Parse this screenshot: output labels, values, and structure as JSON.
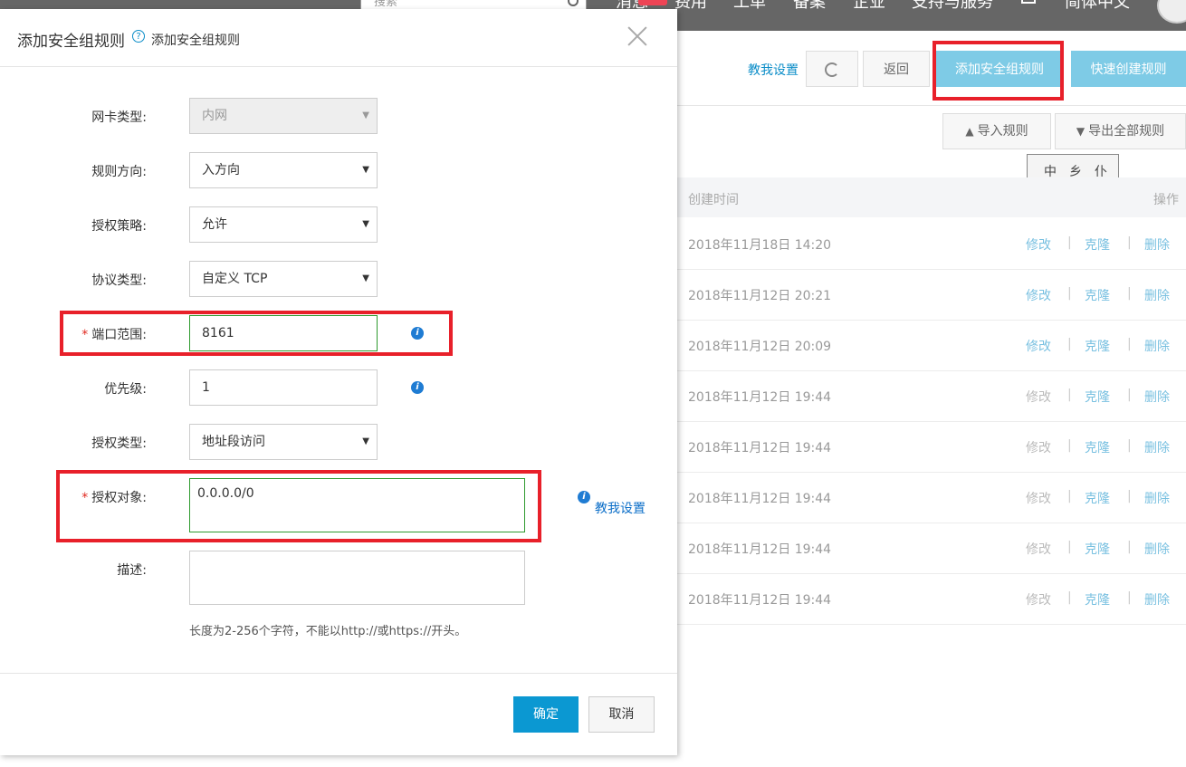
{
  "topbar": {
    "search_placeholder": "搜索",
    "nav": [
      "消息",
      "费用",
      "工单",
      "备案",
      "企业",
      "支持与服务",
      "简体中文"
    ]
  },
  "toolbar": {
    "teach_link": "教我设置",
    "back_button": "返回",
    "add_rule_button": "添加安全组规则",
    "quick_create_button": "快速创建规则",
    "import_button": "导入规则",
    "export_button": "导出全部规则"
  },
  "seal": [
    "中",
    "乡",
    "仆"
  ],
  "table": {
    "col_created": "创建时间",
    "col_actions": "操作",
    "actions": {
      "edit": "修改",
      "clone": "克隆",
      "delete": "删除"
    },
    "rows": [
      {
        "time": "2018年11月18日 14:20",
        "edit_enabled": true
      },
      {
        "time": "2018年11月12日 20:21",
        "edit_enabled": true
      },
      {
        "time": "2018年11月12日 20:09",
        "edit_enabled": true
      },
      {
        "time": "2018年11月12日 19:44",
        "edit_enabled": false
      },
      {
        "time": "2018年11月12日 19:44",
        "edit_enabled": false
      },
      {
        "time": "2018年11月12日 19:44",
        "edit_enabled": false
      },
      {
        "time": "2018年11月12日 19:44",
        "edit_enabled": false
      },
      {
        "time": "2018年11月12日 19:44",
        "edit_enabled": false
      }
    ]
  },
  "modal": {
    "title": "添加安全组规则",
    "help_link": "添加安全组规则",
    "fields": {
      "nic_type": {
        "label": "网卡类型:",
        "value": "内网"
      },
      "direction": {
        "label": "规则方向:",
        "value": "入方向"
      },
      "policy": {
        "label": "授权策略:",
        "value": "允许"
      },
      "protocol": {
        "label": "协议类型:",
        "value": "自定义 TCP"
      },
      "port_range": {
        "label": "端口范围:",
        "value": "8161"
      },
      "priority": {
        "label": "优先级:",
        "value": "1"
      },
      "auth_type": {
        "label": "授权类型:",
        "value": "地址段访问"
      },
      "auth_object": {
        "label": "授权对象:",
        "value": "0.0.0.0/0"
      },
      "description": {
        "label": "描述:",
        "value": ""
      }
    },
    "required_mark": "*",
    "teach_link": "教我设置",
    "description_hint": "长度为2-256个字符，不能以http://或https://开头。",
    "ok_button": "确定",
    "cancel_button": "取消"
  },
  "colors": {
    "accent": "#0b98d2",
    "highlight_box": "#e8202a",
    "valid_border": "#2e9a2e"
  }
}
